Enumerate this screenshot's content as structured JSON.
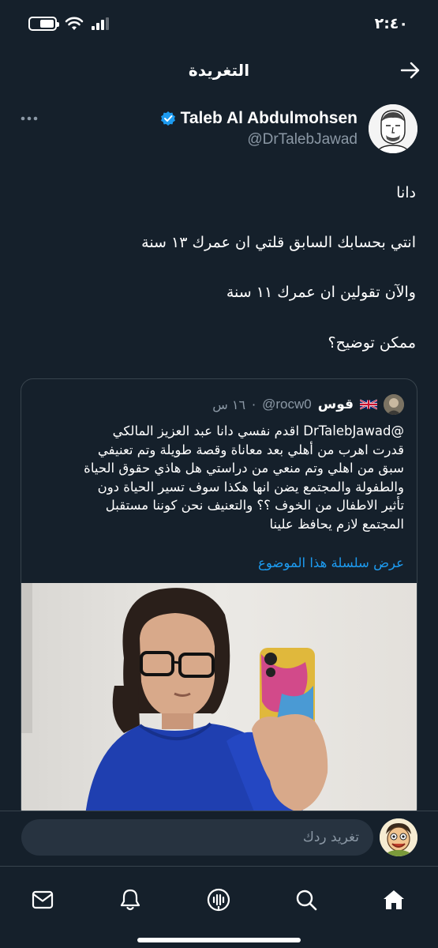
{
  "status_bar": {
    "time": "٢:٤٠"
  },
  "header": {
    "title": "التغريدة"
  },
  "tweet": {
    "author": {
      "display_name": "Taleb Al Abdulmohsen",
      "handle": "@DrTalebJawad",
      "verified": true
    },
    "lines": [
      "دانا",
      "انتي بحسابك السابق قلتي ان عمرك ١٣ سنة",
      "والآن تقولين ان عمرك ١١ سنة",
      "ممكن توضيح؟"
    ],
    "quote": {
      "author_name": "قوس",
      "flag": "🇬🇧",
      "handle": "@rocw0",
      "time": "١٦ س",
      "mention": "@DrTalebJawad",
      "lines": [
        "اقدم نفسي دانا عبد العزيز المالكي",
        "قدرت اهرب من أهلي بعد معاناة وقصة طويلة وتم تعنيفي",
        "سبق من اهلي وتم منعي من دراستي هل هاذي حقوق الحياة",
        "والطفولة والمجتمع يضن انها هكذا سوف تسير الحياة دون",
        "تأثير الاطفال من الخوف ؟؟ والتعنيف نحن كوننا مستقبل",
        "المجتمع لازم يحافظ علينا"
      ],
      "show_thread": "عرض سلسلة هذا الموضوع"
    }
  },
  "reply": {
    "placeholder": "تغريد ردك"
  },
  "tabs": [
    {
      "id": "messages",
      "icon": "mail-icon"
    },
    {
      "id": "notifications",
      "icon": "bell-icon"
    },
    {
      "id": "spaces",
      "icon": "spaces-icon"
    },
    {
      "id": "search",
      "icon": "search-icon"
    },
    {
      "id": "home",
      "icon": "home-icon"
    }
  ],
  "colors": {
    "background": "#15202b",
    "accent": "#1d9bf0",
    "secondary_text": "#8b98a5",
    "border": "#38444d"
  }
}
